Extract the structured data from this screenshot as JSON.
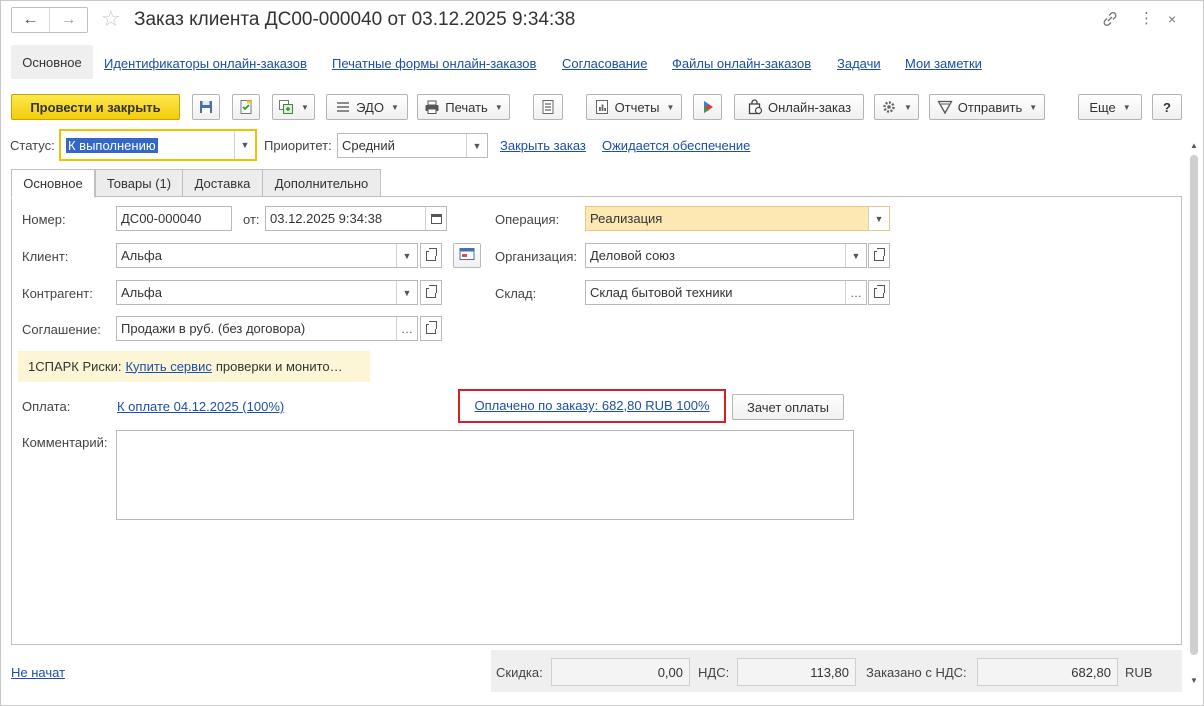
{
  "window": {
    "title": "Заказ клиента ДС00-000040 от 03.12.2025 9:34:38",
    "back_glyph": "←",
    "forward_glyph": "→",
    "icons": [
      "link-icon",
      "more-vert-icon",
      "close-icon"
    ]
  },
  "sections": {
    "active": "Основное",
    "links": [
      "Идентификаторы онлайн-заказов",
      "Печатные формы онлайн-заказов",
      "Согласование",
      "Файлы онлайн-заказов",
      "Задачи",
      "Мои заметки"
    ]
  },
  "toolbar": {
    "post_close": "Провести и закрыть",
    "edo": "ЭДО",
    "print": "Печать",
    "reports": "Отчеты",
    "online_order": "Онлайн-заказ",
    "send": "Отправить",
    "more": "Еще",
    "help": "?"
  },
  "status_row": {
    "status_label": "Статус:",
    "status_value": "К выполнению",
    "priority_label": "Приоритет:",
    "priority_value": "Средний",
    "close_order": "Закрыть заказ",
    "awaiting": "Ожидается обеспечение"
  },
  "tabs": [
    "Основное",
    "Товары (1)",
    "Доставка",
    "Дополнительно"
  ],
  "form": {
    "number_label": "Номер:",
    "number_value": "ДС00-000040",
    "from_label": "от:",
    "date_value": "03.12.2025  9:34:38",
    "client_label": "Клиент:",
    "client_value": "Альфа",
    "counterparty_label": "Контрагент:",
    "counterparty_value": "Альфа",
    "agreement_label": "Соглашение:",
    "agreement_value": "Продажи в руб. (без договора)",
    "operation_label": "Операция:",
    "operation_value": "Реализация",
    "org_label": "Организация:",
    "org_value": "Деловой союз",
    "warehouse_label": "Склад:",
    "warehouse_value": "Склад бытовой техники",
    "spark_prefix": "1СПАРК Риски:",
    "spark_link": "Купить сервис",
    "spark_suffix": "проверки и монито…",
    "payment_label": "Оплата:",
    "payment_link": "К оплате 04.12.2025 (100%)",
    "paid_link": "Оплачено по заказу: 682,80 RUB 100%",
    "offset_button": "Зачет оплаты",
    "comment_label": "Комментарий:",
    "comment_value": ""
  },
  "footer": {
    "status_link": "Не начат",
    "discount_label": "Скидка:",
    "discount_value": "0,00",
    "vat_label": "НДС:",
    "vat_value": "113,80",
    "ordered_label": "Заказано с НДС:",
    "ordered_value": "682,80",
    "currency": "RUB"
  },
  "colors": {
    "primary_button": "#f3cc0c",
    "link": "#1c4fa8",
    "highlight_border": "#d42020",
    "operation_bg": "#fde8b4",
    "spark_bg": "#fdf6d6",
    "status_focus": "#f2c200"
  }
}
